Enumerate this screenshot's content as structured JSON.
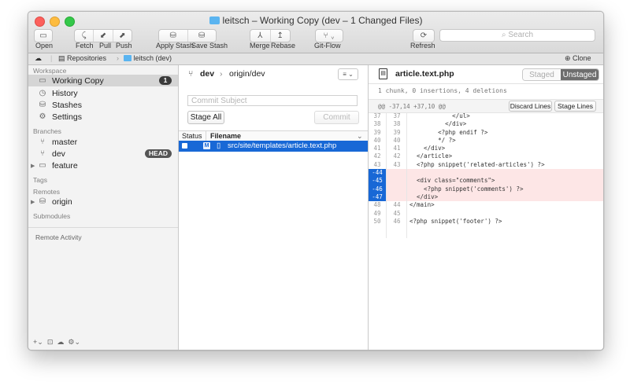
{
  "window": {
    "title": "leitsch – Working Copy (dev – 1 Changed Files)"
  },
  "toolbar": {
    "open_label": "Open",
    "fetch_label": "Fetch",
    "pull_label": "Pull",
    "push_label": "Push",
    "apply_stash_label": "Apply Stash",
    "save_stash_label": "Save Stash",
    "merge_label": "Merge",
    "rebase_label": "Rebase",
    "gitflow_label": "Git-Flow",
    "refresh_label": "Refresh",
    "search_placeholder": "Search"
  },
  "pathbar": {
    "repositories": "Repositories",
    "repo": "leitsch (dev)",
    "clone": "Clone"
  },
  "sidebar": {
    "workspace_header": "Workspace",
    "workspace_items": [
      {
        "label": "Working Copy",
        "badge": "1"
      },
      {
        "label": "History"
      },
      {
        "label": "Stashes"
      },
      {
        "label": "Settings"
      }
    ],
    "branches_header": "Branches",
    "branches": [
      {
        "label": "master"
      },
      {
        "label": "dev",
        "badge": "HEAD"
      },
      {
        "label": "feature"
      }
    ],
    "tags_header": "Tags",
    "remotes_header": "Remotes",
    "remotes": [
      {
        "label": "origin"
      }
    ],
    "submodules_header": "Submodules",
    "remote_activity_header": "Remote Activity"
  },
  "commit": {
    "branch": "dev",
    "remote": "origin/dev",
    "subject_placeholder": "Commit Subject",
    "stage_all": "Stage All",
    "commit_button": "Commit"
  },
  "files": {
    "col_status": "Status",
    "col_filename": "Filename",
    "rows": [
      {
        "status": "M",
        "filename": "src/site/templates/article.text.php"
      }
    ]
  },
  "diff": {
    "filename": "article.text.php",
    "staged": "Staged",
    "unstaged": "Unstaged",
    "summary": "1 chunk, 0 insertions, 4 deletions",
    "hunk_header": "@@ -37,14 +37,10 @@",
    "discard_lines": "Discard Lines",
    "stage_lines": "Stage Lines",
    "lines": [
      {
        "old": "37",
        "new": "37",
        "text": "            </ul>",
        "type": "ctx"
      },
      {
        "old": "38",
        "new": "38",
        "text": "          </div>",
        "type": "ctx"
      },
      {
        "old": "39",
        "new": "39",
        "text": "        <?php endif ?>",
        "type": "ctx"
      },
      {
        "old": "40",
        "new": "40",
        "text": "        */ ?>",
        "type": "ctx"
      },
      {
        "old": "41",
        "new": "41",
        "text": "    </div>",
        "type": "ctx"
      },
      {
        "old": "42",
        "new": "42",
        "text": "  </article>",
        "type": "ctx"
      },
      {
        "old": "43",
        "new": "43",
        "text": "  <?php snippet('related-articles') ?>",
        "type": "ctx"
      },
      {
        "old": "-44",
        "new": "",
        "text": "",
        "type": "del"
      },
      {
        "old": "-45",
        "new": "",
        "text": "  <div class=\"comments\">",
        "type": "del"
      },
      {
        "old": "-46",
        "new": "",
        "text": "    <?php snippet('comments') ?>",
        "type": "del"
      },
      {
        "old": "-47",
        "new": "",
        "text": "  </div>",
        "type": "del"
      },
      {
        "old": "48",
        "new": "44",
        "text": "</main>",
        "type": "ctx"
      },
      {
        "old": "49",
        "new": "45",
        "text": "",
        "type": "ctx"
      },
      {
        "old": "50",
        "new": "46",
        "text": "<?php snippet('footer') ?>",
        "type": "ctx"
      }
    ]
  },
  "colors": {
    "selection": "#1868d6",
    "deleted_bg": "#fde6e6",
    "badge": "#3a3a3a"
  }
}
